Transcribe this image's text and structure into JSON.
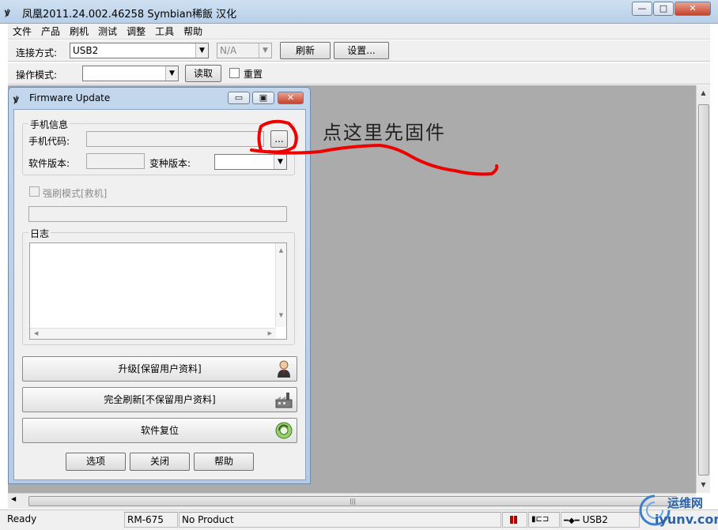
{
  "window": {
    "title": "凤凰2011.24.002.46258  Symbian稀飯 汉化",
    "controls": {
      "minimize": "—",
      "maximize": "□",
      "close": "✕"
    }
  },
  "menu": {
    "items": [
      "文件",
      "产品",
      "刷机",
      "测试",
      "调整",
      "工具",
      "帮助"
    ]
  },
  "toolbar1": {
    "connection_label": "连接方式:",
    "connection_value": "USB2",
    "secondary_value": "N/A",
    "refresh_label": "刷新",
    "settings_label": "设置..."
  },
  "toolbar2": {
    "mode_label": "操作模式:",
    "mode_value": "",
    "read_label": "读取",
    "reset_label": "重置"
  },
  "firmware_window": {
    "title": "Firmware Update",
    "phone_info_caption": "手机信息",
    "phone_code_label": "手机代码:",
    "browse_label": "...",
    "sw_version_label": "软件版本:",
    "variant_version_label": "变种版本:",
    "force_flash_label": "强刷模式[救机]",
    "log_caption": "日志",
    "upgrade_label": "升级[保留用户资料]",
    "full_flash_label": "完全刷新[不保留用户资料]",
    "software_reset_label": "软件复位",
    "options_label": "选项",
    "close_label": "关闭",
    "help_label": "帮助"
  },
  "annotation": {
    "text": "点这里先固件",
    "color": "#ff0000"
  },
  "statusbar": {
    "state": "Ready",
    "model": "RM-675",
    "product": "No Product",
    "connection": "USB2"
  },
  "watermark": {
    "cn": "运维网",
    "en": "iyunv.com"
  }
}
